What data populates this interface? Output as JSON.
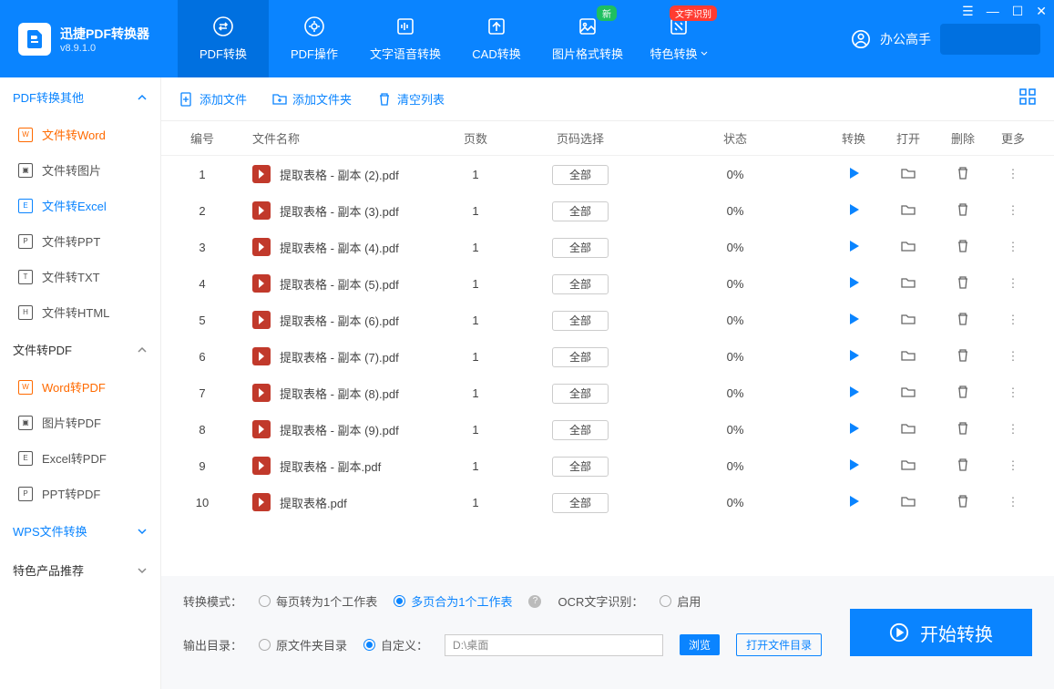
{
  "app": {
    "name": "迅捷PDF转换器",
    "version": "v8.9.1.0"
  },
  "header_tabs": [
    {
      "label": "PDF转换",
      "icon": "swap",
      "active": true
    },
    {
      "label": "PDF操作",
      "icon": "gear"
    },
    {
      "label": "文字语音转换",
      "icon": "audio"
    },
    {
      "label": "CAD转换",
      "icon": "cad"
    },
    {
      "label": "图片格式转换",
      "icon": "image",
      "badge": "新",
      "badge_color": "green"
    },
    {
      "label": "特色转换",
      "icon": "magic",
      "badge": "文字识别",
      "badge_color": "red",
      "dropdown": true
    }
  ],
  "user": {
    "name": "办公高手"
  },
  "sidebar": {
    "groups": [
      {
        "title": "PDF转换其他",
        "expanded": true,
        "color": "blue",
        "items": [
          {
            "label": "文件转Word",
            "icon": "W",
            "active": true
          },
          {
            "label": "文件转图片",
            "icon": "▣"
          },
          {
            "label": "文件转Excel",
            "icon": "E",
            "color": "blue"
          },
          {
            "label": "文件转PPT",
            "icon": "P"
          },
          {
            "label": "文件转TXT",
            "icon": "T"
          },
          {
            "label": "文件转HTML",
            "icon": "H"
          }
        ]
      },
      {
        "title": "文件转PDF",
        "expanded": true,
        "items": [
          {
            "label": "Word转PDF",
            "icon": "W",
            "active": true
          },
          {
            "label": "图片转PDF",
            "icon": "▣"
          },
          {
            "label": "Excel转PDF",
            "icon": "E"
          },
          {
            "label": "PPT转PDF",
            "icon": "P"
          }
        ]
      },
      {
        "title": "WPS文件转换",
        "expanded": false,
        "color": "blue"
      },
      {
        "title": "特色产品推荐",
        "expanded": false
      }
    ]
  },
  "toolbar": {
    "add_file": "添加文件",
    "add_folder": "添加文件夹",
    "clear_list": "清空列表"
  },
  "table": {
    "headers": {
      "num": "编号",
      "name": "文件名称",
      "pages": "页数",
      "select": "页码选择",
      "status": "状态",
      "convert": "转换",
      "open": "打开",
      "delete": "删除",
      "more": "更多"
    },
    "rows": [
      {
        "num": "1",
        "name": "提取表格 - 副本 (2).pdf",
        "pages": "1",
        "select": "全部",
        "status": "0%"
      },
      {
        "num": "2",
        "name": "提取表格 - 副本 (3).pdf",
        "pages": "1",
        "select": "全部",
        "status": "0%"
      },
      {
        "num": "3",
        "name": "提取表格 - 副本 (4).pdf",
        "pages": "1",
        "select": "全部",
        "status": "0%"
      },
      {
        "num": "4",
        "name": "提取表格 - 副本 (5).pdf",
        "pages": "1",
        "select": "全部",
        "status": "0%"
      },
      {
        "num": "5",
        "name": "提取表格 - 副本 (6).pdf",
        "pages": "1",
        "select": "全部",
        "status": "0%"
      },
      {
        "num": "6",
        "name": "提取表格 - 副本 (7).pdf",
        "pages": "1",
        "select": "全部",
        "status": "0%"
      },
      {
        "num": "7",
        "name": "提取表格 - 副本 (8).pdf",
        "pages": "1",
        "select": "全部",
        "status": "0%"
      },
      {
        "num": "8",
        "name": "提取表格 - 副本 (9).pdf",
        "pages": "1",
        "select": "全部",
        "status": "0%"
      },
      {
        "num": "9",
        "name": "提取表格 - 副本.pdf",
        "pages": "1",
        "select": "全部",
        "status": "0%"
      },
      {
        "num": "10",
        "name": "提取表格.pdf",
        "pages": "1",
        "select": "全部",
        "status": "0%"
      }
    ]
  },
  "bottom": {
    "mode_label": "转换模式：",
    "mode_opt1": "每页转为1个工作表",
    "mode_opt2": "多页合为1个工作表",
    "ocr_label": "OCR文字识别：",
    "ocr_enable": "启用",
    "output_label": "输出目录：",
    "output_opt1": "原文件夹目录",
    "output_opt2": "自定义：",
    "path": "D:\\桌面",
    "browse": "浏览",
    "open_dir": "打开文件目录",
    "start": "开始转换"
  }
}
